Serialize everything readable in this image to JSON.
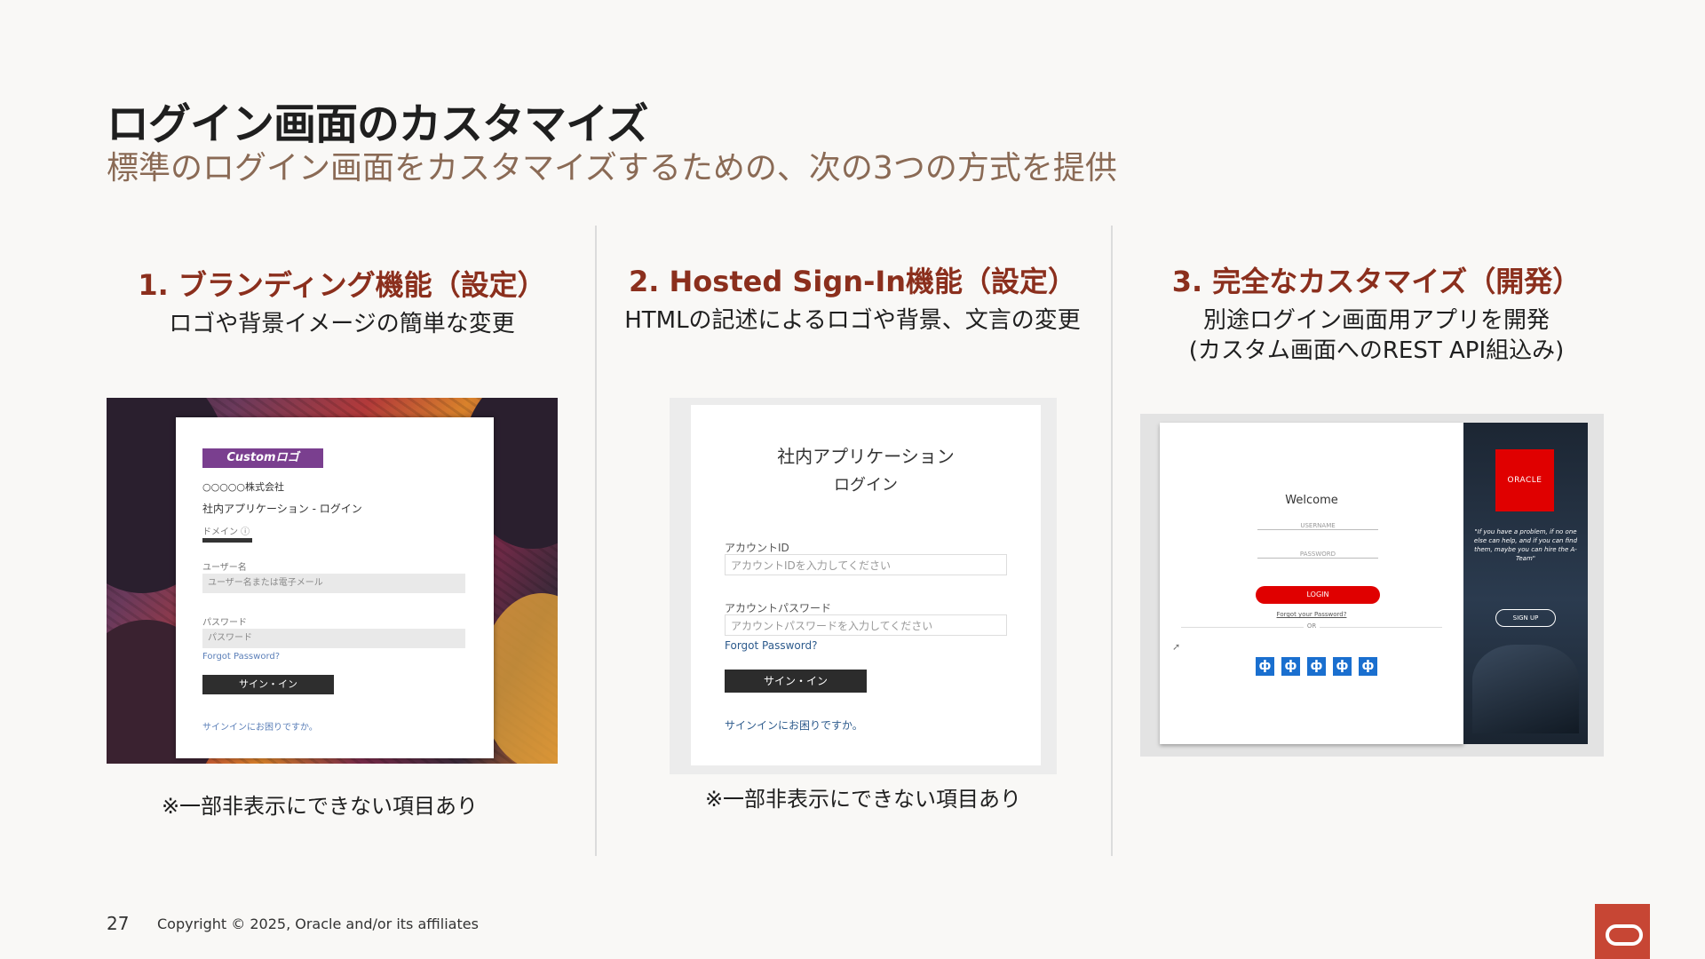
{
  "slide": {
    "title": "ログイン画面のカスタマイズ",
    "subtitle": "標準のログイン画面をカスタマイズするための、次の3つの方式を提供",
    "page_number": "27",
    "copyright": "Copyright © 2025, Oracle and/or its affiliates"
  },
  "columns": [
    {
      "title": "1.  ブランディング機能（設定）",
      "description": "ロゴや背景イメージの簡単な変更",
      "note": "※一部非表示にできない項目あり"
    },
    {
      "title": "2.  Hosted Sign-In機能（設定）",
      "description": "HTMLの記述によるロゴや背景、文言の変更",
      "note": "※一部非表示にできない項目あり"
    },
    {
      "title": "3.  完全なカスタマイズ（開発）",
      "description_line1": "別途ログイン画面用アプリを開発",
      "description_line2": "(カスタム画面へのREST API組込み)"
    }
  ],
  "shot1": {
    "logo": "Customロゴ",
    "company": "○○○○○株式会社",
    "app_title": "社内アプリケーション - ログイン",
    "domain_label": "ドメイン ⓘ",
    "username_label": "ユーザー名",
    "username_placeholder": "ユーザー名または電子メール",
    "password_label": "パスワード",
    "password_placeholder": "パスワード",
    "forgot": "Forgot Password?",
    "signin_button": "サイン・イン",
    "help_link": "サインインにお困りですか。"
  },
  "shot2": {
    "heading1": "社内アプリケーション",
    "heading2": "ログイン",
    "account_label": "アカウントID",
    "account_placeholder": "アカウントIDを入力してください",
    "password_label": "アカウントパスワード",
    "password_placeholder": "アカウントパスワードを入力してください",
    "forgot": "Forgot Password?",
    "signin_button": "サイン・イン",
    "help_link": "サインインにお困りですか。"
  },
  "shot3": {
    "welcome": "Welcome",
    "username": "USERNAME",
    "password": "PASSWORD",
    "login_button": "LOGIN",
    "forgot": "Forgot your Password?",
    "or": "OR",
    "oracle_logo": "ORACLE",
    "quote": "\"If you have a problem, if no one else can help, and if you can find them, maybe you can hire the A-Team\"",
    "signup_button": "SIGN UP",
    "social_icon_glyph": "ф"
  },
  "colors": {
    "accent": "#8b2f1d",
    "subtitle": "#8a6a55",
    "oracle_red": "#c74634"
  }
}
